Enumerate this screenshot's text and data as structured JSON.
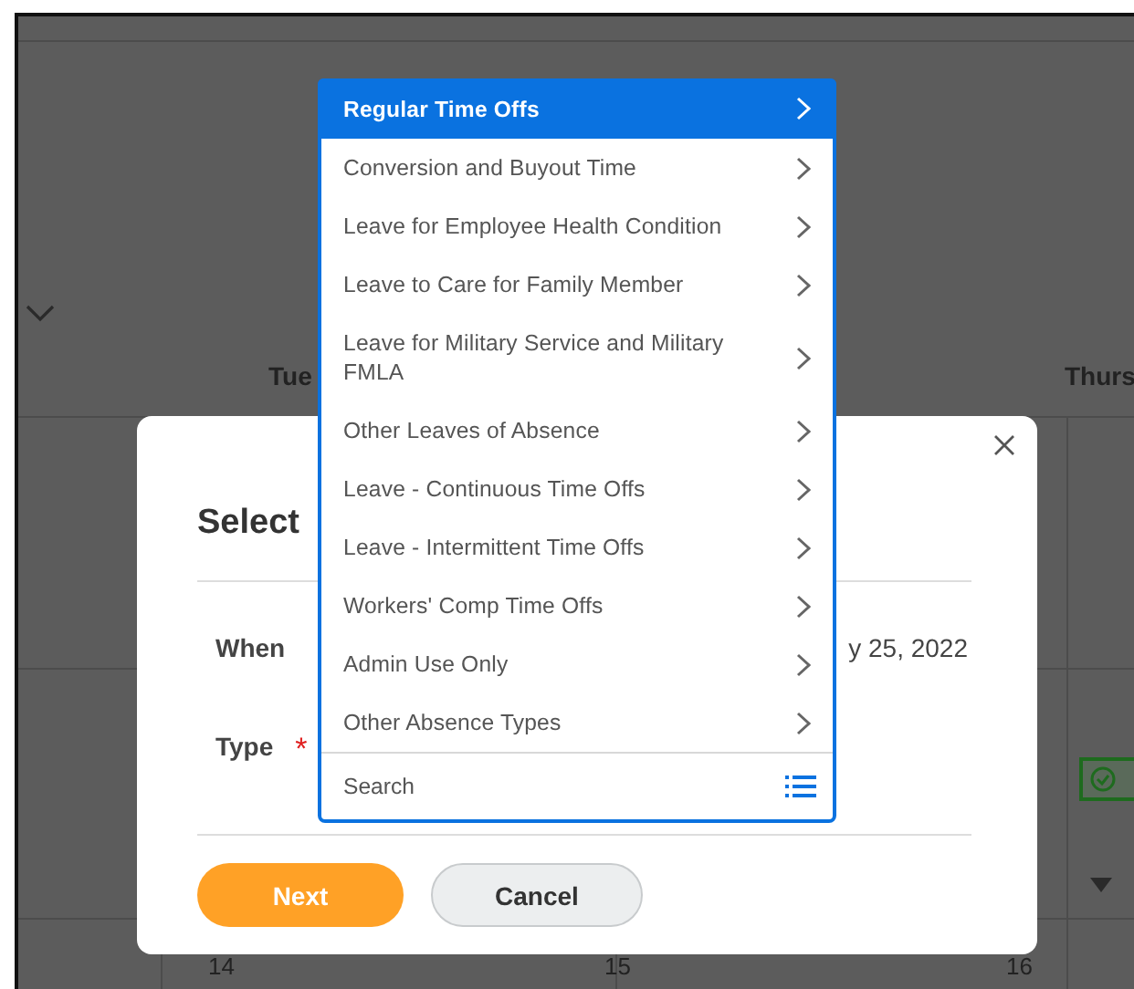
{
  "calendar": {
    "day_headers": [
      {
        "label": "Tue",
        "kind": "left"
      },
      {
        "label": "Thurs",
        "kind": "right"
      }
    ],
    "dates": [
      "14",
      "15",
      "16"
    ]
  },
  "dialog": {
    "title": "Select",
    "fields": [
      {
        "label": "When",
        "required": false,
        "value": "y 25, 2022"
      },
      {
        "label": "Type",
        "required": true,
        "required_mark": "*"
      }
    ],
    "buttons": [
      {
        "label": "Next",
        "kind": "primary"
      },
      {
        "label": "Cancel",
        "kind": "secondary"
      }
    ]
  },
  "menu": {
    "items": [
      {
        "label": "Regular Time Offs",
        "selected": true
      },
      {
        "label": "Conversion and Buyout Time",
        "selected": false
      },
      {
        "label": "Leave for Employee Health Condition",
        "selected": false
      },
      {
        "label": "Leave to Care for Family Member",
        "selected": false
      },
      {
        "label": "Leave for Military Service and Military FMLA",
        "selected": false
      },
      {
        "label": "Other Leaves of Absence",
        "selected": false
      },
      {
        "label": "Leave - Continuous Time Offs",
        "selected": false
      },
      {
        "label": "Leave - Intermittent Time Offs",
        "selected": false
      },
      {
        "label": "Workers' Comp Time Offs",
        "selected": false
      },
      {
        "label": "Admin Use Only",
        "selected": false
      },
      {
        "label": "Other Absence Types",
        "selected": false
      }
    ],
    "search": {
      "placeholder": "Search"
    }
  }
}
